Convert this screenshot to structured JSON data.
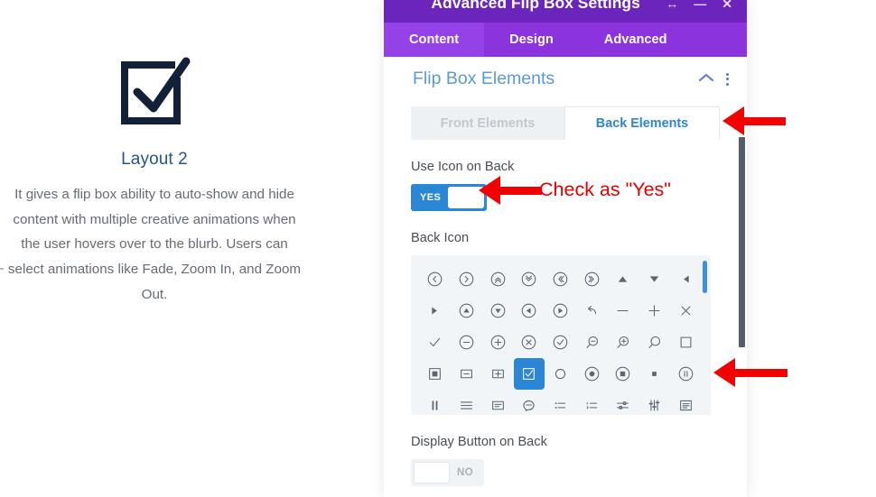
{
  "preview": {
    "icon": "checkbox-checked-icon",
    "title": "Layout 2",
    "body": "It gives a flip box ability to auto-show and hide content with multiple creative animations when the user hovers over to the blurb. Users can select animations like Fade, Zoom In, and Zoom Out."
  },
  "panel": {
    "title": "Advanced Flip Box Settings",
    "titlebar_icons": [
      "expand-icon",
      "minimize-icon",
      "close-icon"
    ],
    "tabs": [
      {
        "label": "Content",
        "active": true
      },
      {
        "label": "Design",
        "active": false
      },
      {
        "label": "Advanced",
        "active": false
      }
    ],
    "section": {
      "title": "Flip Box Elements",
      "collapse_icon": "chevron-up-icon",
      "menu_icon": "vertical-dots-icon"
    },
    "subtabs": [
      {
        "label": "Front Elements",
        "active": false
      },
      {
        "label": "Back Elements",
        "active": true
      }
    ],
    "use_icon_on_back": {
      "label": "Use Icon on Back",
      "value": "YES",
      "state": "on"
    },
    "back_icon": {
      "label": "Back Icon",
      "selected_index": 30,
      "icons": [
        "chevron-left-circle-icon",
        "chevron-right-circle-icon",
        "chevrons-up-circle-icon",
        "chevrons-down-circle-icon",
        "chevrons-left-circle-icon",
        "chevrons-right-circle-icon",
        "triangle-up-icon",
        "triangle-down-icon",
        "triangle-left-icon",
        "triangle-right-icon",
        "triangle-up-circle-icon",
        "triangle-down-circle-icon",
        "triangle-left-circle-icon",
        "triangle-right-circle-icon",
        "undo-arrow-icon",
        "minus-icon",
        "plus-icon",
        "close-x-icon",
        "check-icon",
        "minus-circle-icon",
        "plus-circle-icon",
        "x-circle-icon",
        "check-circle-icon",
        "zoom-out-icon",
        "zoom-in-icon",
        "search-icon",
        "square-icon",
        "square-filled-icon",
        "square-minus-icon",
        "square-plus-icon",
        "checkbox-checked-icon",
        "circle-icon",
        "radio-dot-icon",
        "circle-square-icon",
        "stop-square-icon",
        "pause-circle-icon",
        "pause-icon",
        "list-lines-icon",
        "text-box-icon",
        "speech-lines-icon",
        "bullet-list-icon",
        "numbered-list-icon",
        "sliders-icon",
        "equalizer-icon",
        "document-lines-icon"
      ]
    },
    "display_button_on_back": {
      "label": "Display Button on Back",
      "value": "NO",
      "state": "off"
    }
  },
  "annotations": {
    "check_as_yes": "Check as \"Yes\"",
    "arrow_color": "#f40000",
    "arrows": [
      "arrow-to-back-elements",
      "arrow-to-toggle",
      "arrow-to-icon-row"
    ]
  }
}
